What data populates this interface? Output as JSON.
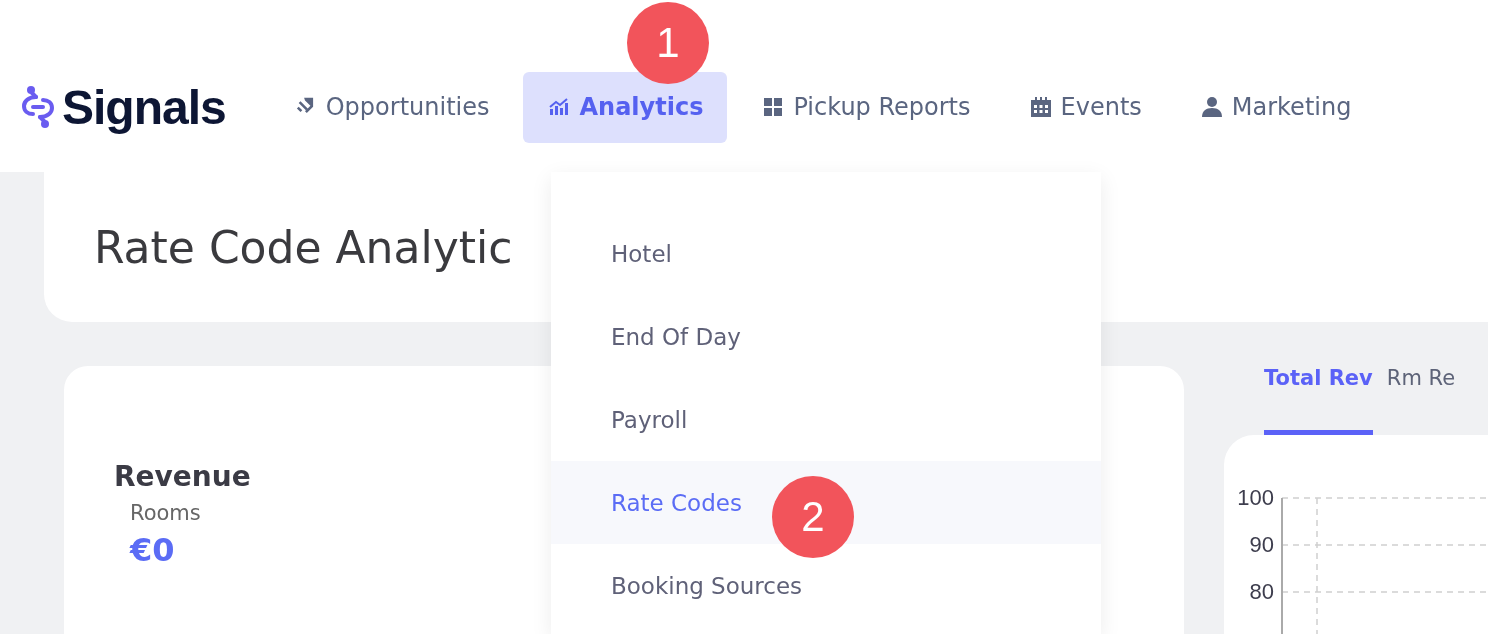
{
  "logo": {
    "text": "Signals"
  },
  "nav": [
    {
      "label": "Opportunities",
      "kind": "tag",
      "selected": false
    },
    {
      "label": "Analytics",
      "kind": "chart",
      "selected": true
    },
    {
      "label": "Pickup Reports",
      "kind": "grid",
      "selected": false
    },
    {
      "label": "Events",
      "kind": "calendar",
      "selected": false
    },
    {
      "label": "Marketing",
      "kind": "person",
      "selected": false
    }
  ],
  "page_title": "Rate Code Analytic",
  "revenue_card": {
    "title": "Revenue",
    "subtitle": "Rooms",
    "value": "€0"
  },
  "chart_tabs": [
    {
      "label": "Total Rev",
      "selected": true
    },
    {
      "label": "Rm Re",
      "selected": false
    }
  ],
  "chart": {
    "y_tick_labels": [
      "100",
      "90",
      "80"
    ]
  },
  "dropdown": {
    "items": [
      {
        "label": "Hotel",
        "selected": false
      },
      {
        "label": "End Of Day",
        "selected": false
      },
      {
        "label": "Payroll",
        "selected": false
      },
      {
        "label": "Rate Codes",
        "selected": true
      },
      {
        "label": "Booking Sources",
        "selected": false
      }
    ]
  },
  "step_badges": [
    {
      "text": "1"
    },
    {
      "text": "2"
    }
  ]
}
